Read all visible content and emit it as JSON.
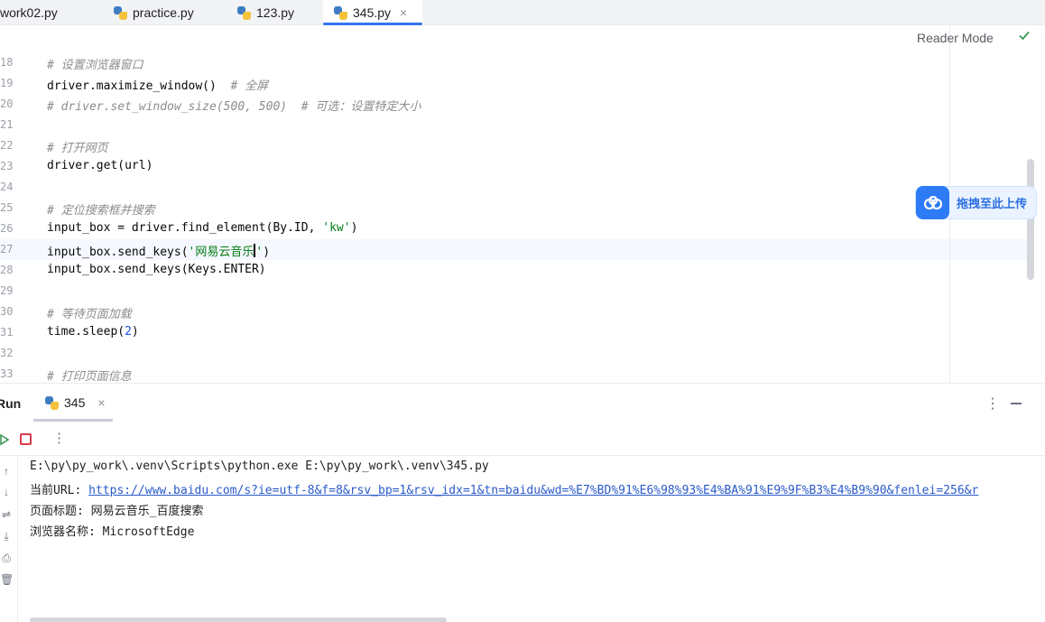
{
  "tabs": [
    {
      "label": "work02.py",
      "active": false
    },
    {
      "label": "practice.py",
      "active": false
    },
    {
      "label": "123.py",
      "active": false
    },
    {
      "label": "345.py",
      "active": true
    }
  ],
  "editor": {
    "reader_mode": "Reader Mode",
    "lines": [
      {
        "n": "18",
        "segments": [
          {
            "t": "# 设置浏览器窗口",
            "c": "cm"
          }
        ]
      },
      {
        "n": "19",
        "segments": [
          {
            "t": "driver.maximize_window()  ",
            "c": ""
          },
          {
            "t": "# 全屏",
            "c": "cm"
          }
        ]
      },
      {
        "n": "20",
        "segments": [
          {
            "t": "# driver.set_window_size(500, 500)  # 可选：设置特定大小",
            "c": "cm"
          }
        ]
      },
      {
        "n": "21",
        "segments": []
      },
      {
        "n": "22",
        "segments": [
          {
            "t": "# 打开网页",
            "c": "cm"
          }
        ]
      },
      {
        "n": "23",
        "segments": [
          {
            "t": "driver.get(url)",
            "c": ""
          }
        ]
      },
      {
        "n": "24",
        "segments": []
      },
      {
        "n": "25",
        "segments": [
          {
            "t": "# 定位搜索框并搜索",
            "c": "cm"
          }
        ]
      },
      {
        "n": "26",
        "segments": [
          {
            "t": "input_box = driver.find_element(By.ID, ",
            "c": ""
          },
          {
            "t": "'kw'",
            "c": "str"
          },
          {
            "t": ")",
            "c": ""
          }
        ]
      },
      {
        "n": "27",
        "segments": [
          {
            "t": "input_box.send_keys(",
            "c": ""
          },
          {
            "t": "'网易云音乐",
            "c": "str"
          },
          {
            "t": "|",
            "c": "caret"
          },
          {
            "t": "'",
            "c": "str"
          },
          {
            "t": ")",
            "c": ""
          }
        ],
        "current": true
      },
      {
        "n": "28",
        "segments": [
          {
            "t": "input_box.send_keys(Keys.ENTER)",
            "c": ""
          }
        ]
      },
      {
        "n": "29",
        "segments": []
      },
      {
        "n": "30",
        "segments": [
          {
            "t": "# 等待页面加载",
            "c": "cm"
          }
        ]
      },
      {
        "n": "31",
        "segments": [
          {
            "t": "time.sleep(",
            "c": ""
          },
          {
            "t": "2",
            "c": "num"
          },
          {
            "t": ")",
            "c": ""
          }
        ]
      },
      {
        "n": "32",
        "segments": []
      },
      {
        "n": "33",
        "segments": [
          {
            "t": "# 打印页面信息",
            "c": "cm"
          }
        ]
      }
    ]
  },
  "upload_widget": {
    "label": "拖拽至此上传"
  },
  "run_panel": {
    "title": "Run",
    "tab_label": "345",
    "console": {
      "line1": "E:\\py\\py_work\\.venv\\Scripts\\python.exe E:\\py\\py_work\\.venv\\345.py",
      "url_label": "当前URL: ",
      "url": "https://www.baidu.com/s?ie=utf-8&f=8&rsv_bp=1&rsv_idx=1&tn=baidu&wd=%E7%BD%91%E6%98%93%E4%BA%91%E9%9F%B3%E4%B9%90&fenlei=256&r",
      "line3": "页面标题: 网易云音乐_百度搜索",
      "line4": "浏览器名称: MicrosoftEdge"
    }
  },
  "colors": {
    "accent": "#3574f0",
    "stop": "#db3b4b",
    "string": "#067d17",
    "comment": "#8c8c8c",
    "link": "#2a5ac9"
  }
}
